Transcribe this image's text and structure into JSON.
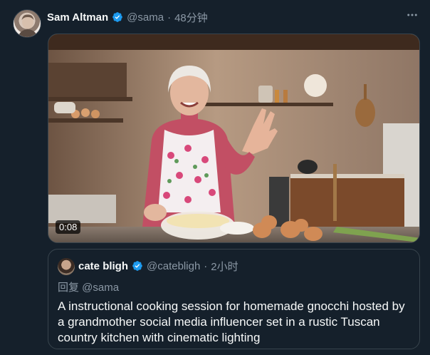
{
  "post": {
    "author_name": "Sam Altman",
    "author_handle": "@sama",
    "separator": "·",
    "time": "48分钟",
    "more_icon": "more-horizontal-icon",
    "verified_icon": "verified-badge-icon"
  },
  "video": {
    "duration": "0:08"
  },
  "quote": {
    "author_name": "cate bligh",
    "author_handle": "@catebligh",
    "separator": "·",
    "time": "2小时",
    "reply_to": "回复 @sama",
    "text": "A instructional cooking session for homemade gnocchi hosted by a grandmother social media influencer set in a rustic Tuscan country kitchen with cinematic lighting"
  },
  "colors": {
    "background": "#15202b",
    "secondary_text": "#8b98a5",
    "border": "#38444d",
    "verified": "#1d9bf0"
  }
}
